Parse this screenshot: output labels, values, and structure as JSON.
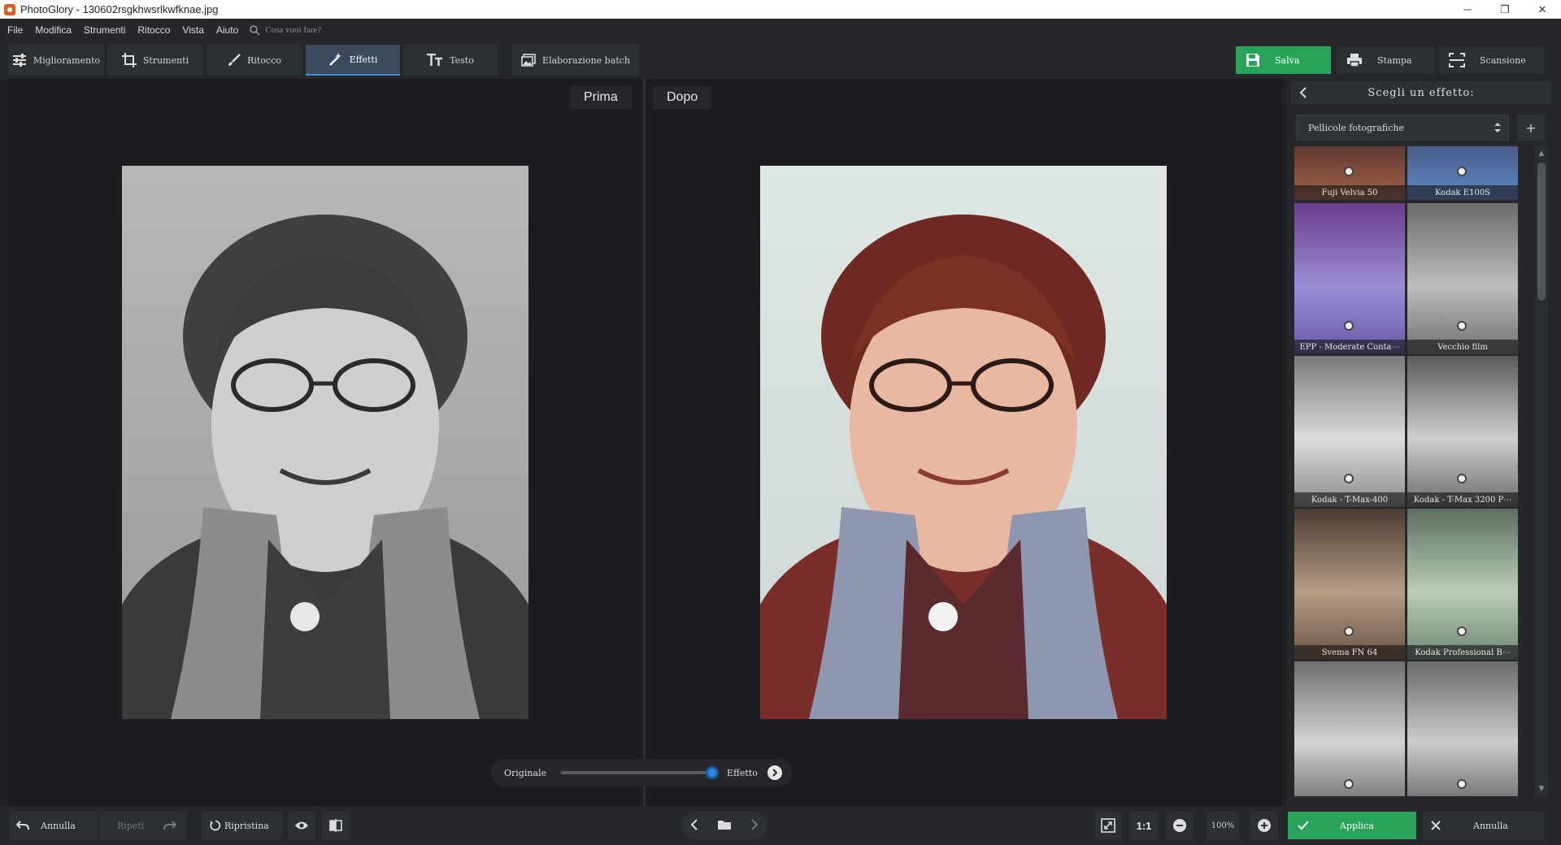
{
  "window": {
    "title": "PhotoGlory - 130602rsgkhwsrlkwfknae.jpg",
    "minimize": "─",
    "restore": "❐",
    "close": "✕"
  },
  "menu": {
    "items": [
      "File",
      "Modifica",
      "Strumenti",
      "Ritocco",
      "Vista",
      "Aiuto"
    ],
    "search_placeholder": "Cosa vuoi fare?"
  },
  "toolbar": {
    "tabs": [
      {
        "label": "Miglioramento",
        "icon": "sliders-icon"
      },
      {
        "label": "Strumenti",
        "icon": "crop-icon"
      },
      {
        "label": "Ritocco",
        "icon": "brush-icon"
      },
      {
        "label": "Effetti",
        "icon": "magic-wand-icon",
        "active": true
      },
      {
        "label": "Testo",
        "icon": "text-icon"
      }
    ],
    "batch_label": "Elaborazione batch",
    "save_label": "Salva",
    "print_label": "Stampa",
    "scan_label": "Scansione"
  },
  "view": {
    "before_label": "Prima",
    "after_label": "Dopo"
  },
  "compare": {
    "left_label": "Originale",
    "right_label": "Effetto",
    "position_fraction": 1.0
  },
  "effects_panel": {
    "title": "Scegli un effetto:",
    "category": "Pellicole fotografiche",
    "add_label": "+",
    "thumbnails": [
      {
        "label": "Fuji Velvia 50"
      },
      {
        "label": "Kodak E100S"
      },
      {
        "label": "EPP - Moderate Conta⋯"
      },
      {
        "label": "Vecchio film"
      },
      {
        "label": "Kodak - T-Max-400"
      },
      {
        "label": "Kodak - T-Max 3200 P⋯"
      },
      {
        "label": "Svema FN 64"
      },
      {
        "label": "Kodak Professional B⋯"
      },
      {
        "label": ""
      },
      {
        "label": ""
      }
    ]
  },
  "bottom": {
    "undo_label": "Annulla",
    "redo_label": "Ripeti",
    "reset_label": "Ripristina",
    "zoom_1to1": "1:1",
    "zoom_value": "100%",
    "apply_label": "Applica",
    "cancel_label": "Annulla"
  },
  "colors": {
    "accent_green": "#2aa35a",
    "accent_blue": "#2d8ae0"
  }
}
